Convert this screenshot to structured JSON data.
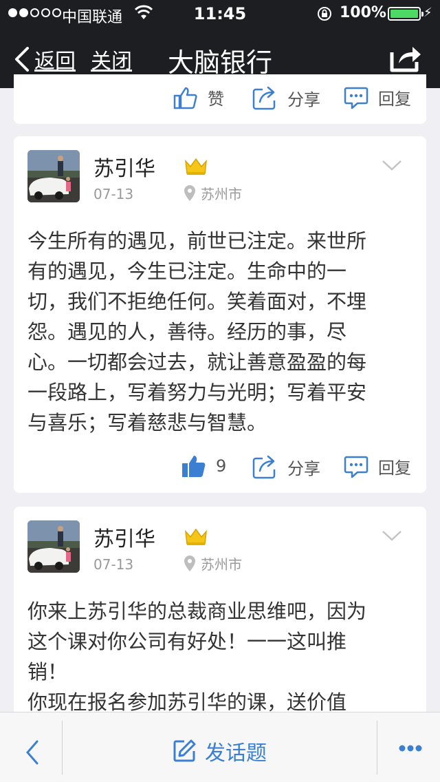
{
  "status_bar": {
    "carrier": "中国联通",
    "time": "11:45",
    "battery": "100%"
  },
  "nav": {
    "back": "返回",
    "close": "关闭",
    "title": "大脑银行"
  },
  "top_card": {
    "like": "赞",
    "share": "分享",
    "reply": "回复"
  },
  "posts": [
    {
      "author": "苏引华",
      "date": "07-13",
      "location": "苏州市",
      "body": "今生所有的遇见，前世已注定。来世所\n有的遇见，今生已注定。生命中的一\n切，我们不拒绝任何。笑着面对，不埋\n怨。遇见的人，善待。经历的事，尽\n心。一切都会过去，就让善意盈盈的每\n一段路上，写着努力与光明；写着平安\n与喜乐；写着慈悲与智慧。",
      "likes": "9",
      "share": "分享",
      "reply": "回复"
    },
    {
      "author": "苏引华",
      "date": "07-13",
      "location": "苏州市",
      "body": "你来上苏引华的总裁商业思维吧，因为\n这个课对你公司有好处！一一这叫推\n销！\n你现在报名参加苏引华的课，送价值"
    }
  ],
  "bottom": {
    "compose": "发话题"
  },
  "colors": {
    "nav_bg": "#1c1e22",
    "accent": "#3b7fd3",
    "battery": "#4cd964",
    "crown": "#f5c518"
  }
}
